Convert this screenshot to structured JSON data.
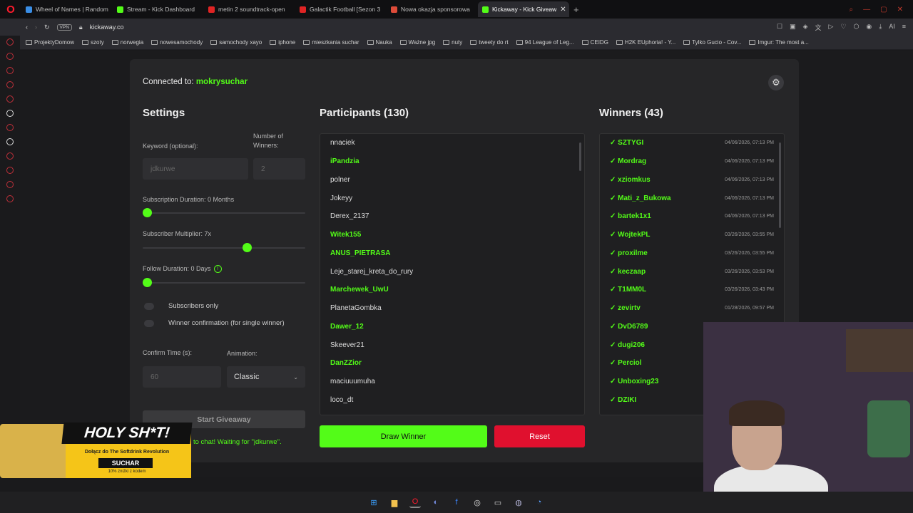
{
  "browser": {
    "tabs": [
      {
        "title": "Wheel of Names | Random",
        "color": "#3a8ee6"
      },
      {
        "title": "Stream - Kick Dashboard",
        "color": "#53fc18"
      },
      {
        "title": "metin 2 soundtrack-open",
        "color": "#e02424"
      },
      {
        "title": "Galactik Football [Sezon 3",
        "color": "#e02424"
      },
      {
        "title": "Nowa okazja sponsorowa",
        "color": "#dd4b39"
      },
      {
        "title": "Kickaway - Kick Giveaw",
        "color": "#53fc18",
        "active": true
      }
    ],
    "url": "kickaway.co",
    "vpn": "VPN",
    "bookmarks": [
      "ProjektyDomow",
      "szoty",
      "norwegia",
      "nowesamochody",
      "samochody xayo",
      "iphone",
      "mieszkania suchar",
      "Nauka",
      "Ważne jpg",
      "nuty",
      "tweety do rt",
      "94 League of Leg...",
      "CEIDG",
      "H2K EUphoria! - Y...",
      "Tylko Gucio - Cov...",
      "Imgur: The most a..."
    ]
  },
  "app": {
    "connected_label": "Connected to:",
    "connected_user": "mokrysuchar",
    "settings": {
      "title": "Settings",
      "keyword_label": "Keyword (optional):",
      "keyword_value": "jdkurwe",
      "winners_label": "Number of Winners:",
      "winners_value": "2",
      "sub_duration_label": "Subscription Duration: 0 Months",
      "sub_duration_value": 0,
      "sub_multiplier_label": "Subscriber Multiplier: 7x",
      "sub_multiplier_value": 0.65,
      "follow_duration_label": "Follow Duration:  0  Days",
      "follow_duration_value": 0,
      "info_glyph": "!",
      "subscribers_only_label": "Subscribers only",
      "winner_confirmation_label": "Winner confirmation (for single winner)",
      "confirm_time_label": "Confirm Time (s):",
      "confirm_time_value": "60",
      "animation_label": "Animation:",
      "animation_value": "Classic",
      "start_button": "Start Giveaway",
      "waiting_text": "to chat! Waiting for \"jdkurwe\"."
    },
    "participants": {
      "title": "Participants (130)",
      "items": [
        {
          "name": "nnaciek",
          "sub": false
        },
        {
          "name": "iPandzia",
          "sub": true
        },
        {
          "name": "polner",
          "sub": false
        },
        {
          "name": "Jokeyy",
          "sub": false
        },
        {
          "name": "Derex_2137",
          "sub": false
        },
        {
          "name": "Witek155",
          "sub": true
        },
        {
          "name": "ANUS_PIETRASA",
          "sub": true
        },
        {
          "name": "Leje_starej_kreta_do_rury",
          "sub": false
        },
        {
          "name": "Marchewek_UwU",
          "sub": true
        },
        {
          "name": "PlanetaGombka",
          "sub": false
        },
        {
          "name": "Dawer_12",
          "sub": true
        },
        {
          "name": "Skeever21",
          "sub": false
        },
        {
          "name": "DanZZior",
          "sub": true
        },
        {
          "name": "maciuuumuha",
          "sub": false
        },
        {
          "name": "loco_dt",
          "sub": false
        }
      ]
    },
    "winners": {
      "title": "Winners (43)",
      "items": [
        {
          "name": "✓ SZTYGI",
          "date": "04/06/2026, 07:13 PM"
        },
        {
          "name": "✓ Mordrag",
          "date": "04/06/2026, 07:13 PM"
        },
        {
          "name": "✓ xziomkus",
          "date": "04/06/2026, 07:13 PM"
        },
        {
          "name": "✓ Mati_z_Bukowa",
          "date": "04/06/2026, 07:13 PM"
        },
        {
          "name": "✓ bartek1x1",
          "date": "04/06/2026, 07:13 PM"
        },
        {
          "name": "✓ WojtekPL",
          "date": "03/26/2026, 03:55 PM"
        },
        {
          "name": "✓ proxilme",
          "date": "03/26/2026, 03:55 PM"
        },
        {
          "name": "✓ keczaap",
          "date": "03/26/2026, 03:53 PM"
        },
        {
          "name": "✓ T1MM0L",
          "date": "03/26/2026, 03:43 PM"
        },
        {
          "name": "✓ zevirtv",
          "date": "01/28/2026, 09:57 PM"
        },
        {
          "name": "✓ DvD6789",
          "date": ""
        },
        {
          "name": "✓ dugi206",
          "date": ""
        },
        {
          "name": "✓ Perciol",
          "date": ""
        },
        {
          "name": "✓ Unboxing23",
          "date": ""
        },
        {
          "name": "✓ DZIKI",
          "date": ""
        }
      ]
    },
    "draw_button": "Draw Winner",
    "reset_button": "Reset"
  },
  "promo": {
    "headline": "HOLY SH*T!",
    "line1": "Dołącz do The Softdrink Revolution",
    "code": "SUCHAR",
    "line2": "10% zniżki z kodem"
  },
  "colors": {
    "accent": "#53fc18",
    "danger": "#e0102e",
    "background": "#1b1b1d",
    "card": "#262628"
  }
}
